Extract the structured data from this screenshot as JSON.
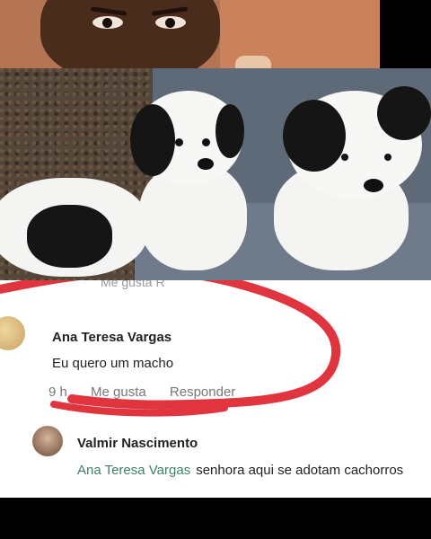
{
  "comments": {
    "cut_off_text": "Me gusta    R",
    "comment1": {
      "author": "Ana Teresa Vargas",
      "text": "Eu quero um macho",
      "time": "9 h",
      "like": "Me gusta",
      "reply": "Responder"
    },
    "comment2": {
      "author": "Valmir Nascimento",
      "mention": "Ana Teresa Vargas",
      "text": "senhora aqui se adotam cachorros"
    }
  },
  "colors": {
    "scribble": "#e0343f",
    "mention": "#3f7f6d"
  }
}
